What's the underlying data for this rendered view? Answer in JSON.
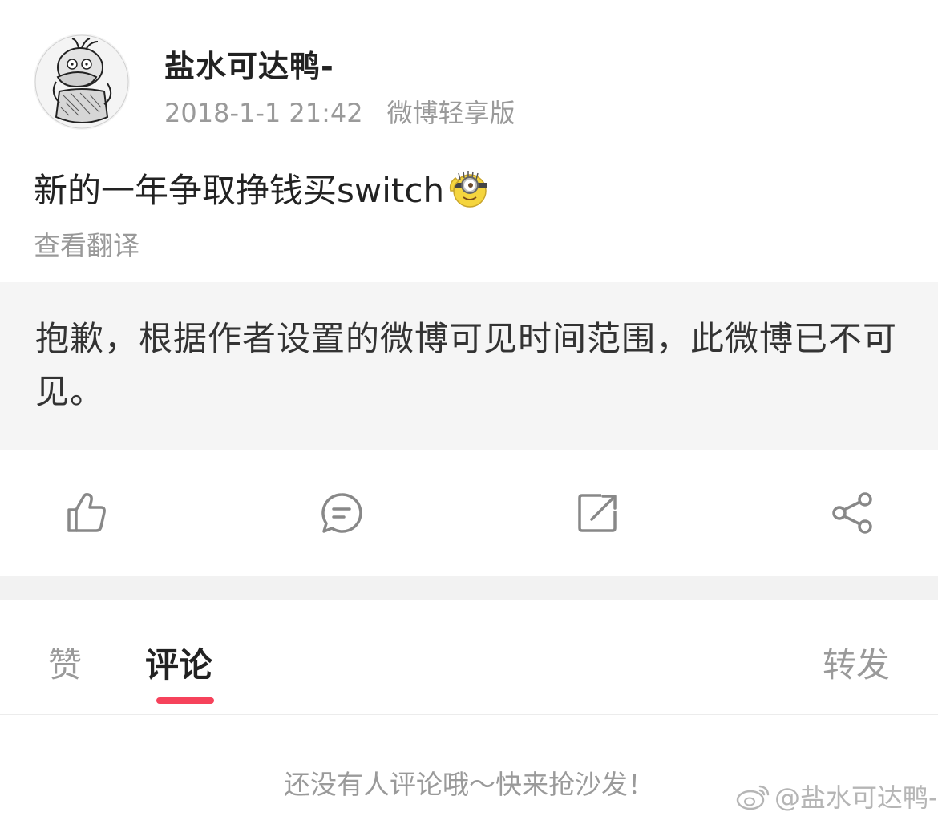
{
  "post": {
    "author_name": "盐水可达鸭-",
    "timestamp": "2018-1-1 21:42",
    "source": "微博轻享版",
    "text": "新的一年争取挣钱买switch",
    "emoji_icon": "minion-emoji-icon",
    "translate_label": "查看翻译",
    "notice": "抱歉，根据作者设置的微博可见时间范围，此微博已不可见。"
  },
  "actions": {
    "like_icon": "thumbs-up-icon",
    "comment_icon": "comment-icon",
    "repost_icon": "repost-icon",
    "share_icon": "share-icon"
  },
  "tabs": [
    {
      "label": "赞",
      "active": false
    },
    {
      "label": "评论",
      "active": true
    },
    {
      "label": "转发",
      "active": false
    }
  ],
  "comments": {
    "empty_text": "还没有人评论哦～快来抢沙发！"
  },
  "watermark": {
    "text": "@盐水可达鸭-"
  },
  "colors": {
    "accent": "#f6425b",
    "notice_bg": "#f5f5f5",
    "muted_text": "#9a9a9a"
  }
}
